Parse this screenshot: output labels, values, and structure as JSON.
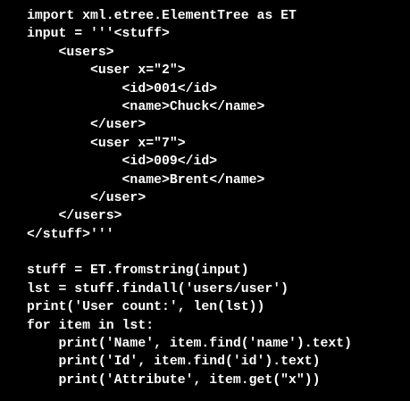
{
  "code": {
    "lines": [
      "import xml.etree.ElementTree as ET",
      "input = '''<stuff>",
      "    <users>",
      "        <user x=\"2\">",
      "            <id>001</id>",
      "            <name>Chuck</name>",
      "        </user>",
      "        <user x=\"7\">",
      "            <id>009</id>",
      "            <name>Brent</name>",
      "        </user>",
      "    </users>",
      "</stuff>'''",
      "",
      "stuff = ET.fromstring(input)",
      "lst = stuff.findall('users/user')",
      "print('User count:', len(lst))",
      "for item in lst:",
      "    print('Name', item.find('name').text)",
      "    print('Id', item.find('id').text)",
      "    print('Attribute', item.get(\"x\"))"
    ]
  },
  "colors": {
    "background": "#000000",
    "text": "#ffffff"
  }
}
